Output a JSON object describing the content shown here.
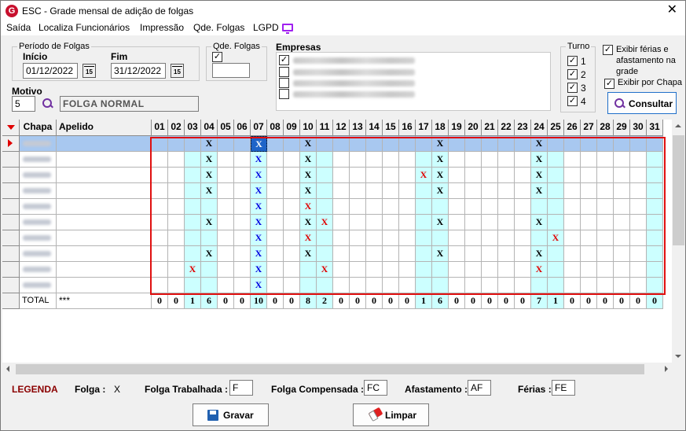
{
  "window": {
    "title": "ESC - Grade mensal de adição de folgas",
    "close_label": "✕"
  },
  "menu": [
    "Saída",
    "Localiza Funcionários",
    "Impressão",
    "Qde. Folgas",
    "LGPD"
  ],
  "periodo": {
    "legend": "Período de Folgas",
    "inicio_label": "Início",
    "inicio_value": "01/12/2022",
    "fim_label": "Fim",
    "fim_value": "31/12/2022",
    "cal_label": "15"
  },
  "qde_folgas": {
    "legend": "Qde. Folgas",
    "checked": "✓",
    "value": ""
  },
  "empresas": {
    "label": "Empresas",
    "checks": [
      "✓",
      "",
      "",
      ""
    ]
  },
  "turno": {
    "legend": "Turno",
    "items": [
      {
        "label": "1",
        "check": "✓"
      },
      {
        "label": "2",
        "check": "✓"
      },
      {
        "label": "3",
        "check": "✓"
      },
      {
        "label": "4",
        "check": "✓"
      }
    ]
  },
  "options": {
    "exibir_ferias_label": "Exibir férias e afastamento na grade",
    "exibir_ferias_check": "✓",
    "exibir_chapa_label": "Exibir por Chapa",
    "exibir_chapa_check": "✓"
  },
  "motivo": {
    "label": "Motivo",
    "code": "5",
    "description": "FOLGA NORMAL"
  },
  "consultar_label": "Consultar",
  "grid": {
    "col_chapa": "Chapa",
    "col_apelido": "Apelido",
    "days": [
      "01",
      "02",
      "03",
      "04",
      "05",
      "06",
      "07",
      "08",
      "09",
      "10",
      "11",
      "12",
      "13",
      "14",
      "15",
      "16",
      "17",
      "18",
      "19",
      "20",
      "21",
      "22",
      "23",
      "24",
      "25",
      "26",
      "27",
      "28",
      "29",
      "30",
      "31"
    ],
    "highlight_days": [
      3,
      4,
      7,
      10,
      11,
      17,
      18,
      24,
      25,
      31
    ],
    "rows": [
      {
        "marks": {
          "04": "X",
          "07": "X",
          "10": "X",
          "18": "X",
          "24": "X"
        },
        "colors": {
          "04": "black",
          "07": "blue",
          "10": "black",
          "18": "black",
          "24": "black"
        }
      },
      {
        "marks": {
          "04": "X",
          "07": "X",
          "10": "X",
          "18": "X",
          "24": "X"
        },
        "colors": {
          "04": "black",
          "07": "blue",
          "10": "black",
          "18": "black",
          "24": "black"
        }
      },
      {
        "marks": {
          "04": "X",
          "07": "X",
          "10": "X",
          "17": "X",
          "18": "X",
          "24": "X"
        },
        "colors": {
          "04": "black",
          "07": "blue",
          "10": "black",
          "17": "red",
          "18": "black",
          "24": "black"
        }
      },
      {
        "marks": {
          "04": "X",
          "07": "X",
          "10": "X",
          "18": "X",
          "24": "X"
        },
        "colors": {
          "04": "black",
          "07": "blue",
          "10": "black",
          "18": "black",
          "24": "black"
        }
      },
      {
        "marks": {
          "07": "X",
          "10": "X"
        },
        "colors": {
          "07": "blue",
          "10": "red"
        }
      },
      {
        "marks": {
          "04": "X",
          "07": "X",
          "10": "X",
          "11": "X",
          "18": "X",
          "24": "X"
        },
        "colors": {
          "04": "black",
          "07": "blue",
          "10": "black",
          "11": "red",
          "18": "black",
          "24": "black"
        }
      },
      {
        "marks": {
          "07": "X",
          "10": "X",
          "25": "X"
        },
        "colors": {
          "07": "blue",
          "10": "red",
          "25": "red"
        }
      },
      {
        "marks": {
          "04": "X",
          "07": "X",
          "10": "X",
          "18": "X",
          "24": "X"
        },
        "colors": {
          "04": "black",
          "07": "blue",
          "10": "black",
          "18": "black",
          "24": "black"
        }
      },
      {
        "marks": {
          "03": "X",
          "07": "X",
          "11": "X",
          "24": "X"
        },
        "colors": {
          "03": "red",
          "07": "blue",
          "11": "red",
          "24": "red"
        }
      },
      {
        "marks": {
          "07": "X"
        },
        "colors": {
          "07": "blue"
        }
      }
    ],
    "total_label": "TOTAL",
    "total_apelido": "***",
    "totals": [
      "0",
      "0",
      "1",
      "6",
      "0",
      "0",
      "10",
      "0",
      "0",
      "8",
      "2",
      "0",
      "0",
      "0",
      "0",
      "0",
      "1",
      "6",
      "0",
      "0",
      "0",
      "0",
      "0",
      "7",
      "1",
      "0",
      "0",
      "0",
      "0",
      "0",
      "0"
    ]
  },
  "legend": {
    "title": "LEGENDA",
    "folga_label": "Folga :",
    "folga_value": "X",
    "trabalhada_label": "Folga Trabalhada :",
    "trabalhada_value": "F",
    "compensada_label": "Folga Compensada :",
    "compensada_value": "FC",
    "afastamento_label": "Afastamento :",
    "afastamento_value": "AF",
    "ferias_label": "Férias :",
    "ferias_value": "FE"
  },
  "buttons": {
    "gravar": "Gravar",
    "limpar": "Limpar"
  },
  "colors": {
    "highlight": "#ccffff",
    "selected_row": "#a8c8f0",
    "mark_red": "#e00000",
    "mark_blue": "#0000e0",
    "accent": "#7030a0"
  }
}
